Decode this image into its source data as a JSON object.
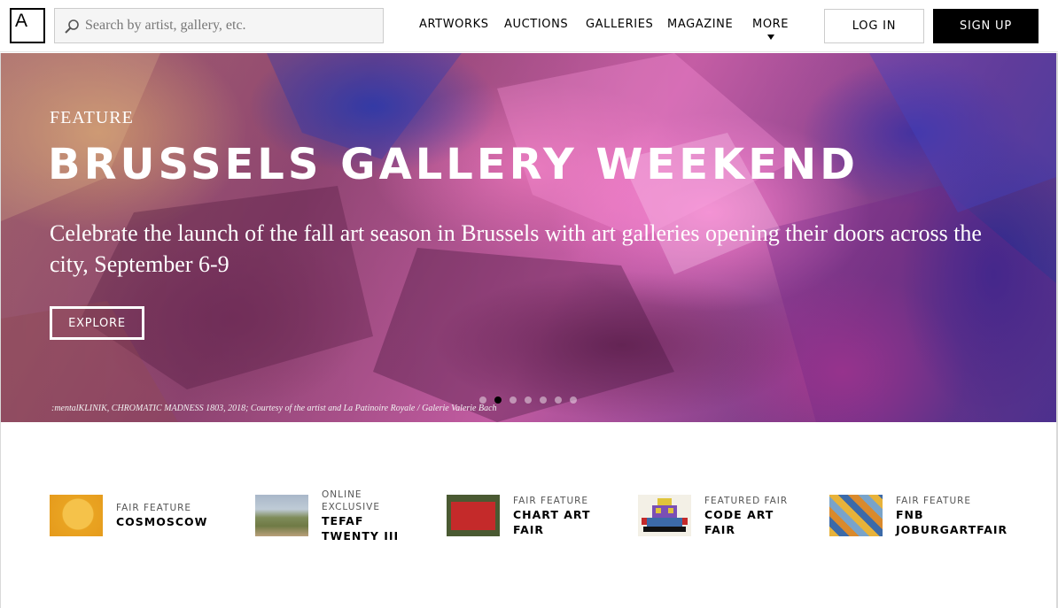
{
  "header": {
    "logo_letter": "A",
    "search": {
      "placeholder": "Search by artist, gallery, etc."
    },
    "nav": [
      "ARTWORKS",
      "AUCTIONS",
      "GALLERIES",
      "MAGAZINE",
      "MORE"
    ],
    "login_label": "LOG IN",
    "signup_label": "SIGN UP"
  },
  "hero": {
    "kicker": "FEATURE",
    "title": "BRUSSELS GALLERY WEEKEND",
    "description": "Celebrate the launch of the fall art season in Brussels with art galleries opening their doors across the city, September 6-9",
    "cta_label": "EXPLORE",
    "credit": ":mentalKLINIK, CHROMATIC MADNESS 1803, 2018; Courtesy of the artist and La Patinoire Royale / Galerie Valerie Bach",
    "carousel": {
      "count": 7,
      "active_index": 1
    }
  },
  "features": [
    {
      "kicker": "FAIR FEATURE",
      "title": "COSMOSCOW"
    },
    {
      "kicker": "ONLINE EXCLUSIVE",
      "title": "TEFAF TWENTY III"
    },
    {
      "kicker": "FAIR FEATURE",
      "title": "CHART ART FAIR"
    },
    {
      "kicker": "FEATURED FAIR",
      "title": "CODE ART FAIR"
    },
    {
      "kicker": "FAIR FEATURE",
      "title": "FNB JOBURGARTFAIR"
    }
  ],
  "colors": {
    "accent": "#000000",
    "text": "#000000",
    "muted": "#555555"
  },
  "icons": [
    "search-icon",
    "caret-down-icon",
    "artsy-logo-icon"
  ]
}
